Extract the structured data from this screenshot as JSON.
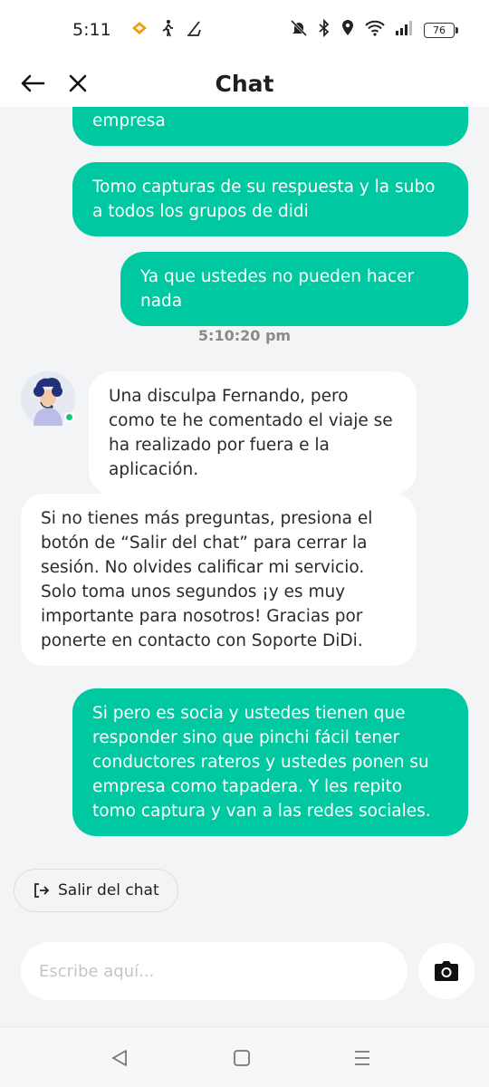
{
  "status_bar": {
    "time": "5:11",
    "battery": "76",
    "icons": [
      "didi-app-icon",
      "walking-icon",
      "sweep-icon",
      "mute-bell-icon",
      "bluetooth-icon",
      "location-icon",
      "wifi-icon",
      "signal-icon",
      "battery-icon"
    ]
  },
  "header": {
    "title": "Chat",
    "back_icon": "arrow-left-icon",
    "close_icon": "close-icon"
  },
  "messages": [
    {
      "side": "out",
      "text": "empresa"
    },
    {
      "side": "out",
      "text": "Tomo capturas de su respuesta y la subo a todos los grupos de didi"
    },
    {
      "side": "out",
      "text": "Ya que ustedes no pueden hacer nada"
    },
    {
      "side": "timestamp",
      "text": "5:10:20 pm"
    },
    {
      "side": "in",
      "text": "Una disculpa Fernando, pero como te he comentado el viaje se ha realizado por fuera e la aplicación."
    },
    {
      "side": "in",
      "text": "Si no tienes más preguntas, presiona el botón de “Salir del chat” para cerrar la sesión. No olvides calificar mi servicio. Solo toma unos segundos ¡y es muy importante para nosotros! Gracias por ponerte en contacto con Soporte DiDi."
    },
    {
      "side": "out",
      "text": "Si pero es socia y ustedes tienen que responder sino que pinchi fácil tener conductores rateros y ustedes ponen su empresa como tapadera. Y les repito tomo captura y van a las redes sociales."
    }
  ],
  "exit_button": {
    "label": "Salir del chat",
    "icon": "exit-icon"
  },
  "composer": {
    "placeholder": "Escribe aquí...",
    "value": "",
    "camera_icon": "camera-icon"
  },
  "nav_bar": {
    "icons": [
      "back-triangle-icon",
      "home-square-icon",
      "menu-lines-icon"
    ]
  },
  "colors": {
    "accent": "#00c8a0",
    "background": "#f3f4f6",
    "incoming_bubble": "#ffffff",
    "online_dot": "#19c37d"
  }
}
